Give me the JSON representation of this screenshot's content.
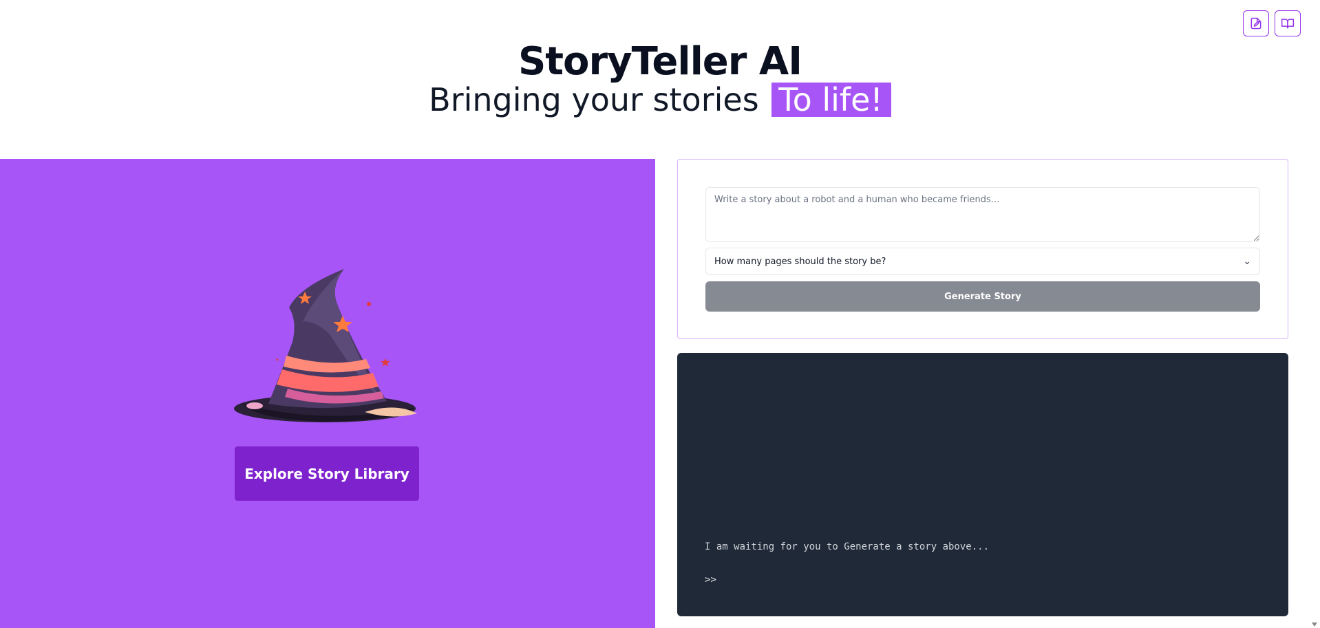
{
  "header": {
    "title": "StoryTeller AI",
    "subtitle_prefix": "Bringing your stories",
    "subtitle_highlight": "To life!"
  },
  "top_icons": [
    "file-edit-icon",
    "book-open-icon"
  ],
  "left_panel": {
    "image": "witch-hat-illustration",
    "explore_button": "Explore Story Library"
  },
  "form": {
    "prompt_placeholder": "Write a story about a robot and a human who became friends...",
    "prompt_value": "",
    "pages_select": "How many pages should the story be?",
    "generate_button": "Generate Story"
  },
  "terminal": {
    "message": "I am waiting for you to Generate a story above...",
    "prompt": ">>"
  },
  "colors": {
    "accent": "#a855f7",
    "accent_dark": "#7e22ce",
    "terminal_bg": "#1f2937",
    "button_disabled": "#868a93"
  }
}
